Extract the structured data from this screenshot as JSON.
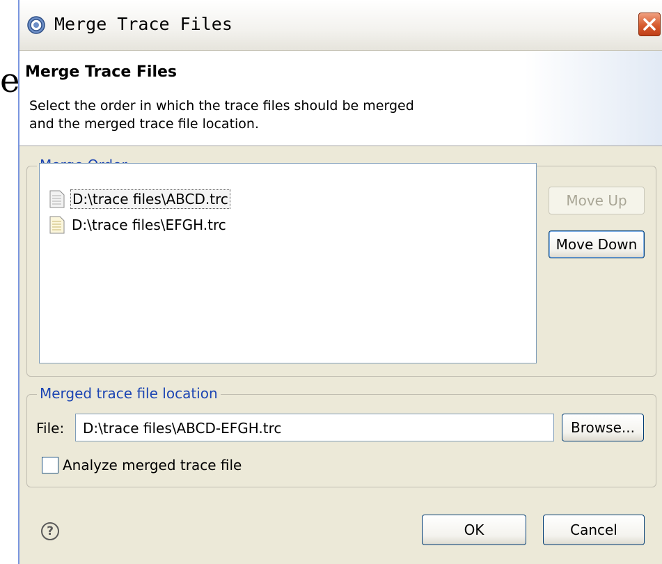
{
  "background_fragment": "e",
  "window": {
    "title": "Merge Trace Files"
  },
  "header": {
    "title": "Merge Trace Files",
    "description_line1": "Select the order in which the trace files should be merged",
    "description_line2": "and the merged trace file location."
  },
  "merge_order": {
    "group_label": "Merge Order",
    "files": [
      {
        "label": "D:\\trace files\\ABCD.trc",
        "selected": true
      },
      {
        "label": "D:\\trace files\\EFGH.trc",
        "selected": false
      }
    ],
    "move_up_label": "Move Up",
    "move_down_label": "Move Down"
  },
  "location": {
    "group_label": "Merged trace file location",
    "file_label": "File:",
    "file_value": "D:\\trace files\\ABCD-EFGH.trc",
    "browse_label": "Browse...",
    "analyze_label": "Analyze merged trace file",
    "analyze_checked": false
  },
  "footer": {
    "help_glyph": "?",
    "ok_label": "OK",
    "cancel_label": "Cancel"
  },
  "colors": {
    "group_label": "#1c45b3",
    "close_button": "#d65b2e",
    "dialog_bg": "#ece9d8"
  }
}
